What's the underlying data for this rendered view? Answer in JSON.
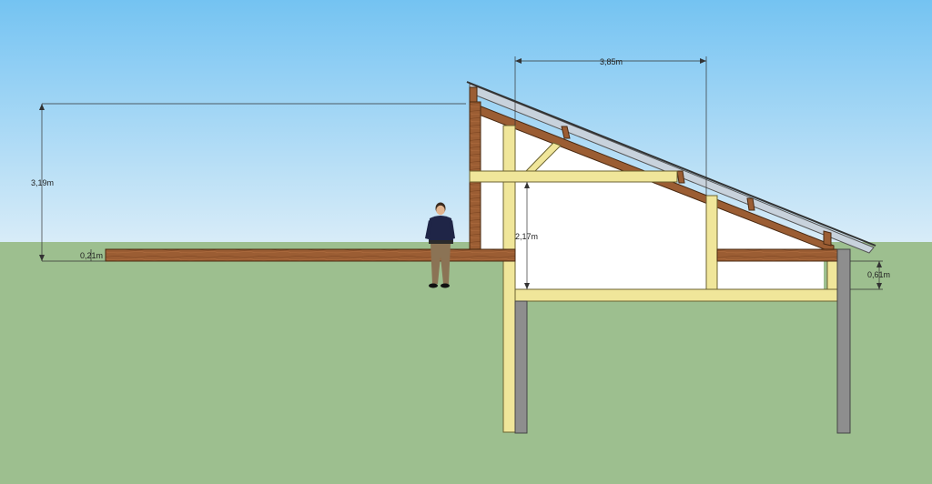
{
  "dimensions": {
    "total_height": "3,19m",
    "deck_thickness": "0,21m",
    "interior_height": "2,17m",
    "roof_span": "3,85m",
    "foundation_height": "0,61m"
  },
  "colors": {
    "sky_top": "#74c3f2",
    "sky_bottom": "#d8ecf8",
    "ground": "#9dbf8f",
    "timber_dark": "#9b5d33",
    "timber_light": "#f0e69a",
    "concrete": "#8e8e8e",
    "glazing": "#c8d2dc",
    "wall_white": "#ffffff"
  },
  "icons": {
    "person": "person-figure-icon"
  }
}
